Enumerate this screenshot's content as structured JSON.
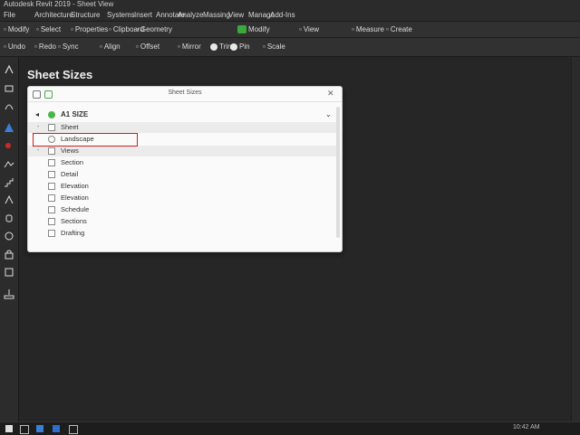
{
  "app": {
    "title": "Autodesk Revit 2019 - Sheet View"
  },
  "menu": [
    "File",
    "Architecture",
    "Structure",
    "Systems",
    "Insert",
    "Annotate",
    "Analyze",
    "Massing",
    "View",
    "Manage",
    "Add-Ins"
  ],
  "toolbar1": [
    {
      "label": "Modify",
      "icon": "modify-icon"
    },
    {
      "label": "Select",
      "icon": "select-icon"
    },
    {
      "label": "Properties",
      "icon": "properties-icon"
    },
    {
      "label": "Clipboard",
      "icon": "clipboard-icon"
    },
    {
      "label": "Geometry",
      "icon": "geometry-icon"
    },
    {
      "label": "Modify",
      "icon": "wrench-icon"
    },
    {
      "label": "View",
      "icon": "view-icon"
    },
    {
      "label": "Measure",
      "icon": "measure-icon"
    },
    {
      "label": "Create",
      "icon": "create-icon"
    }
  ],
  "toolbar2": [
    {
      "label": "Undo",
      "icon": "undo-icon"
    },
    {
      "label": "Redo",
      "icon": "redo-icon"
    },
    {
      "label": "Sync",
      "icon": "sync-icon"
    },
    {
      "label": "Align",
      "icon": "align-icon"
    },
    {
      "label": "Offset",
      "icon": "offset-icon"
    },
    {
      "label": "Mirror",
      "icon": "mirror-icon"
    },
    {
      "label": "Trim",
      "icon": "trim-icon"
    },
    {
      "label": "Pin",
      "icon": "pin-icon"
    },
    {
      "label": "Scale",
      "icon": "scale-icon"
    }
  ],
  "doc_title": "Sheet Sizes",
  "dialog": {
    "title": "Sheet Sizes",
    "root": "A1 SIZE",
    "rows": [
      {
        "label": "Sheet",
        "shade": true,
        "exp": "-"
      },
      {
        "label": "Landscape",
        "shade": false,
        "selected": true
      },
      {
        "label": "Views",
        "shade": true,
        "exp": "-"
      },
      {
        "label": "Section",
        "shade": false
      },
      {
        "label": "Detail",
        "shade": false
      },
      {
        "label": "Elevation",
        "shade": false
      },
      {
        "label": "Elevation",
        "shade": false
      },
      {
        "label": "Schedule",
        "shade": false
      },
      {
        "label": "Sections",
        "shade": false
      },
      {
        "label": "Drafting",
        "shade": false
      }
    ]
  },
  "tray": {
    "time": "10:42 AM"
  }
}
